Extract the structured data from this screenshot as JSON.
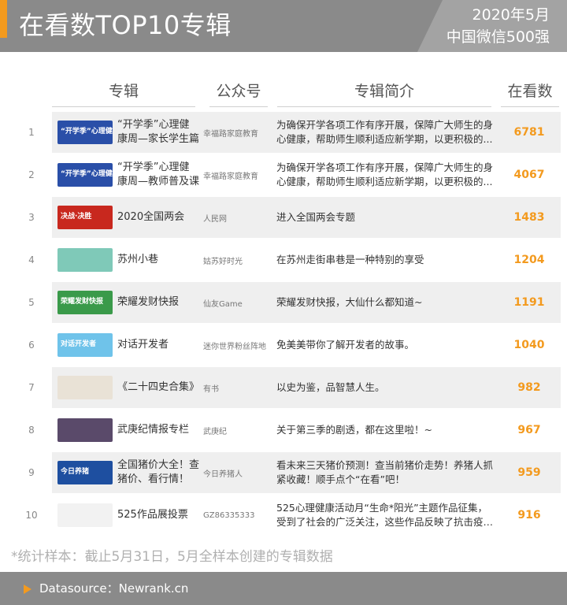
{
  "header": {
    "title": "在看数TOP10专辑",
    "date": "2020年5月",
    "subtitle": "中国微信500强"
  },
  "columns": {
    "album": "专辑",
    "account": "公众号",
    "description": "专辑简介",
    "views": "在看数"
  },
  "rows": [
    {
      "rank": "1",
      "album": "“开学季”心理健康周—家长学生篇",
      "account": "幸福路家庭教育",
      "description": "为确保开学各项工作有序开展，保障广大师生的身心健康，帮助师生顺利适应新学期，以更积极的...",
      "views": "6781",
      "thumb_text": "“开学季”心理健康教育周",
      "thumb_color": "#2a4fa8"
    },
    {
      "rank": "2",
      "album": "“开学季”心理健康周—教师普及课",
      "account": "幸福路家庭教育",
      "description": "为确保开学各项工作有序开展，保障广大师生的身心健康，帮助师生顺利适应新学期，以更积极的...",
      "views": "4067",
      "thumb_text": "“开学季”心理健康教育周",
      "thumb_color": "#2a4fa8"
    },
    {
      "rank": "3",
      "album": "2020全国两会",
      "account": "人民网",
      "description": "进入全国两会专题",
      "views": "1483",
      "thumb_text": "决战·决胜",
      "thumb_color": "#c8281e"
    },
    {
      "rank": "4",
      "album": "苏州小巷",
      "account": "姑苏好时光",
      "description": "在苏州走街串巷是一种特别的享受",
      "views": "1204",
      "thumb_text": "",
      "thumb_color": "#7fc9b8"
    },
    {
      "rank": "5",
      "album": "荣耀发财快报",
      "account": "仙友Game",
      "description": "荣耀发财快报，大仙什么都知道~",
      "views": "1191",
      "thumb_text": "荣耀发财快报",
      "thumb_color": "#3a9a4a"
    },
    {
      "rank": "6",
      "album": "对话开发者",
      "account": "迷你世界粉丝阵地",
      "description": "免美美带你了解开发者的故事。",
      "views": "1040",
      "thumb_text": "对话开发者",
      "thumb_color": "#6fc3ea"
    },
    {
      "rank": "7",
      "album": "《二十四史合集》",
      "account": "有书",
      "description": "以史为鉴，品智慧人生。",
      "views": "982",
      "thumb_text": "",
      "thumb_color": "#e9e2d6"
    },
    {
      "rank": "8",
      "album": "武庚纪情报专栏",
      "account": "武庚纪",
      "description": "关于第三季的剧透，都在这里啦！~",
      "views": "967",
      "thumb_text": "",
      "thumb_color": "#5a4a6a"
    },
    {
      "rank": "9",
      "album": "全国猪价大全！查猪价、看行情！",
      "account": "今日养猪人",
      "description": "看未来三天猪价预测！查当前猪价走势！养猪人抓紧收藏！顺手点个“在看”吧！",
      "views": "959",
      "thumb_text": "今日养猪",
      "thumb_color": "#1e4fa0"
    },
    {
      "rank": "10",
      "album": "525作品展投票",
      "account": "GZ86335333",
      "description": "525心理健康活动月“生命*阳光”主题作品征集，受到了社会的广泛关注，这些作品反映了抗击疫情...",
      "views": "916",
      "thumb_text": "",
      "thumb_color": "#f2f2f2"
    }
  ],
  "note": "*统计样本：截止5月31日，5月全样本创建的专辑数据",
  "footer": {
    "source": "Datasource：Newrank.cn"
  },
  "colors": {
    "accent": "#f39a1e",
    "header_bg": "#8a8a8a",
    "row_bg": "#efefef"
  }
}
